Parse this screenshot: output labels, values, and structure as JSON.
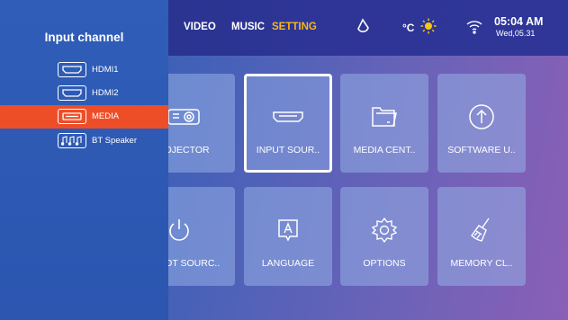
{
  "topbar": {
    "tabs": [
      {
        "label": "VIDEO",
        "active": false
      },
      {
        "label": "MUSIC",
        "active": false
      },
      {
        "label": "SETTING",
        "active": true
      }
    ],
    "temperature_unit": "°C",
    "time": "05:04 AM",
    "date": "Wed,05.31",
    "icons": [
      "rotate-icon",
      "sun-icon",
      "wifi-icon"
    ],
    "active_color": "#f5b81c"
  },
  "panel": {
    "title": "Input channel",
    "items": [
      {
        "label": "HDMI1",
        "icon": "hdmi-port-icon",
        "selected": false
      },
      {
        "label": "HDMI2",
        "icon": "hdmi-port-icon",
        "selected": false
      },
      {
        "label": "MEDIA",
        "icon": "hdmi-port-icon",
        "selected": true
      },
      {
        "label": "BT Speaker",
        "icon": "music-notes-icon",
        "selected": false
      }
    ],
    "selected_color": "#ed4e28"
  },
  "grid": {
    "tiles": [
      {
        "label": "PROJECTOR",
        "icon": "projector-icon"
      },
      {
        "label": "INPUT SOUR..",
        "icon": "hdmi-icon",
        "focused": true
      },
      {
        "label": "MEDIA CENT..",
        "icon": "folder-icon"
      },
      {
        "label": "SOFTWARE U..",
        "icon": "upload-arrow-icon"
      },
      {
        "label": "BOOT SOURC..",
        "icon": "power-icon"
      },
      {
        "label": "LANGUAGE",
        "icon": "language-icon"
      },
      {
        "label": "OPTIONS",
        "icon": "gear-icon"
      },
      {
        "label": "MEMORY CL..",
        "icon": "broom-icon"
      }
    ]
  }
}
